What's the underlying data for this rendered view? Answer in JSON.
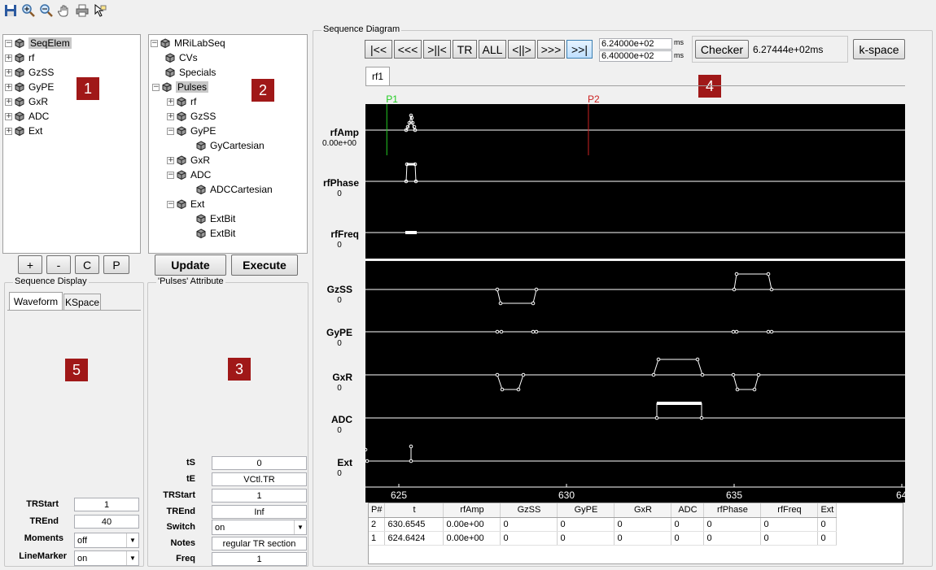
{
  "toolbar": {
    "icons": [
      "save-icon",
      "zoom-in-icon",
      "zoom-out-icon",
      "pan-hand-icon",
      "print-icon",
      "cursor-icon"
    ]
  },
  "seq_elem_tree": {
    "root": "SeqElem",
    "items": [
      "rf",
      "GzSS",
      "GyPE",
      "GxR",
      "ADC",
      "Ext"
    ],
    "badge": "1"
  },
  "seq_tree": {
    "root": "MRiLabSeq",
    "cvs": "CVs",
    "specials": "Specials",
    "pulses": "Pulses",
    "rf": "rf",
    "gzss": "GzSS",
    "gype": "GyPE",
    "gycart": "GyCartesian",
    "gxr": "GxR",
    "adc": "ADC",
    "adccart": "ADCCartesian",
    "ext": "Ext",
    "extbit1": "ExtBit",
    "extbit2": "ExtBit",
    "badge": "2"
  },
  "tree_buttons": {
    "plus": "+",
    "minus": "-",
    "c": "C",
    "p": "P"
  },
  "actions": {
    "update": "Update",
    "execute": "Execute"
  },
  "seq_display": {
    "title": "Sequence Display",
    "tab_waveform": "Waveform",
    "tab_kspace": "KSpace",
    "badge": "5",
    "trstart_label": "TRStart",
    "trstart_value": "1",
    "trend_label": "TREnd",
    "trend_value": "40",
    "moments_label": "Moments",
    "moments_value": "off",
    "linemarker_label": "LineMarker",
    "linemarker_value": "on"
  },
  "attr": {
    "title": "'Pulses' Attribute",
    "badge": "3",
    "rows": [
      {
        "label": "tS",
        "value": "0"
      },
      {
        "label": "tE",
        "value": "VCtl.TR"
      },
      {
        "label": "TRStart",
        "value": "1"
      },
      {
        "label": "TREnd",
        "value": "Inf"
      },
      {
        "label": "Switch",
        "value": "on"
      },
      {
        "label": "Notes",
        "value": "regular TR section"
      },
      {
        "label": "Freq",
        "value": "1"
      }
    ]
  },
  "diagram": {
    "title": "Sequence Diagram",
    "nav": [
      "|<<",
      "<<<",
      ">||<",
      "TR",
      "ALL",
      "<||>",
      ">>>",
      ">>|"
    ],
    "time1": "6.24000e+02",
    "time2": "6.40000e+02",
    "unit1": "ms",
    "unit2": "ms",
    "checker": "Checker",
    "checker_value": "6.27444e+02ms",
    "kspace": "k-space",
    "tab": "rf1",
    "badge": "4",
    "marker_p1": "P1",
    "marker_p2": "P2",
    "channels_rf": [
      {
        "name": "rfAmp",
        "value": "0.00e+00"
      },
      {
        "name": "rfPhase",
        "value": "0"
      },
      {
        "name": "rfFreq",
        "value": "0"
      }
    ],
    "channels_grad": [
      {
        "name": "GzSS",
        "value": "0"
      },
      {
        "name": "GyPE",
        "value": "0"
      },
      {
        "name": "GxR",
        "value": "0"
      },
      {
        "name": "ADC",
        "value": "0"
      },
      {
        "name": "Ext",
        "value": "0"
      }
    ],
    "ticks": [
      "625",
      "630",
      "635",
      "64"
    ],
    "colors": {
      "plot_bg": "#000000",
      "trace": "#ffffff",
      "p1": "#22cc22",
      "p2": "#cc2222"
    }
  },
  "table": {
    "headers": [
      "P#",
      "t",
      "rfAmp",
      "GzSS",
      "GyPE",
      "GxR",
      "ADC",
      "rfPhase",
      "rfFreq",
      "Ext"
    ],
    "rows": [
      [
        "2",
        "630.6545",
        "0.00e+00",
        "0",
        "0",
        "0",
        "0",
        "0",
        "0",
        "0"
      ],
      [
        "1",
        "624.6424",
        "0.00e+00",
        "0",
        "0",
        "0",
        "0",
        "0",
        "0",
        "0"
      ]
    ]
  }
}
